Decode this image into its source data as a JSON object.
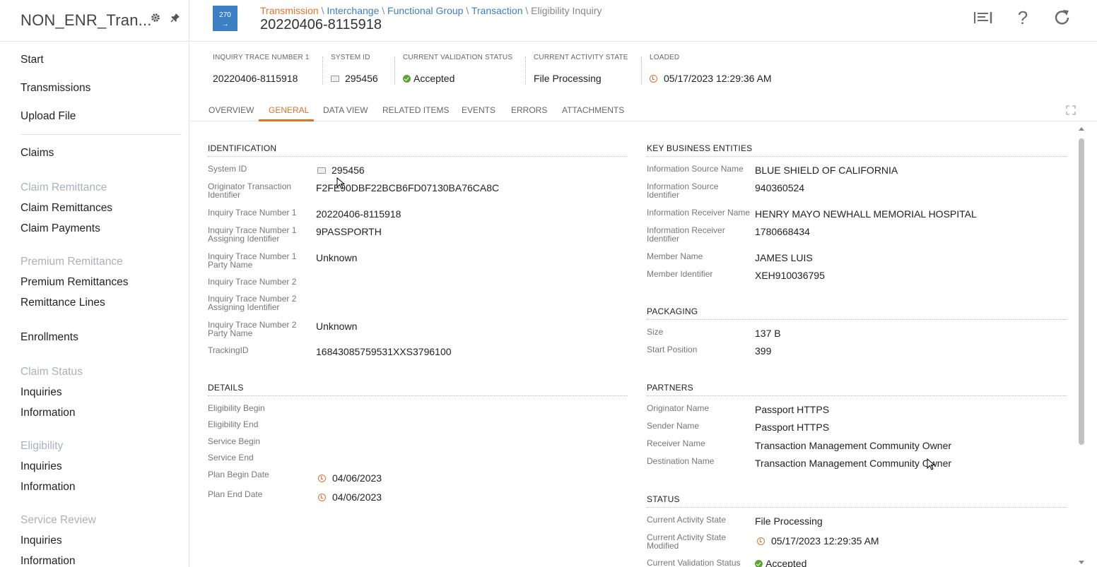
{
  "sidebar": {
    "title": "NON_ENR_Tran...",
    "items": {
      "start": "Start",
      "transmissions": "Transmissions",
      "upload_file": "Upload File",
      "claims": "Claims",
      "claim_remittance_section": "Claim Remittance",
      "claim_remittances": "Claim Remittances",
      "claim_payments": "Claim Payments",
      "premium_remittance_section": "Premium Remittance",
      "premium_remittances": "Premium Remittances",
      "remittance_lines": "Remittance Lines",
      "enrollments": "Enrollments",
      "claim_status_section": "Claim Status",
      "claim_status_inquiries": "Inquiries",
      "claim_status_information": "Information",
      "eligibility_section": "Eligibility",
      "eligibility_inquiries": "Inquiries",
      "eligibility_information": "Information",
      "service_review_section": "Service Review",
      "service_review_inquiries": "Inquiries",
      "service_review_information": "Information"
    }
  },
  "header": {
    "badge_number": "270",
    "badge_arrow": "→",
    "breadcrumb": {
      "transmission": "Transmission",
      "interchange": "Interchange",
      "functional_group": "Functional Group",
      "transaction": "Transaction",
      "current": "Eligibility Inquiry",
      "separator": " \\ "
    },
    "title": "20220406-8115918"
  },
  "summary": {
    "inquiry_trace_label": "INQUIRY TRACE NUMBER 1",
    "inquiry_trace_value": "20220406-8115918",
    "system_id_label": "SYSTEM ID",
    "system_id_value": "295456",
    "validation_label": "CURRENT VALIDATION STATUS",
    "validation_value": "Accepted",
    "activity_label": "CURRENT ACTIVITY STATE",
    "activity_value": "File Processing",
    "loaded_label": "LOADED",
    "loaded_value": "05/17/2023 12:29:36 AM"
  },
  "tabs": {
    "overview": "OVERVIEW",
    "general": "GENERAL",
    "data_view": "DATA VIEW",
    "related_items": "RELATED ITEMS",
    "events": "EVENTS",
    "errors": "ERRORS",
    "attachments": "ATTACHMENTS"
  },
  "identification": {
    "heading": "IDENTIFICATION",
    "system_id_label": "System ID",
    "system_id_value": "295456",
    "originator_label": "Originator Transaction Identifier",
    "originator_value": "F2FE90DBF22BCB6FD07130BA76CA8C",
    "trace1_label": "Inquiry Trace Number 1",
    "trace1_value": "20220406-8115918",
    "trace1_assign_label": "Inquiry Trace Number 1 Assigning Identifier",
    "trace1_assign_value": "9PASSPORTH",
    "trace1_party_label": "Inquiry Trace Number 1 Party Name",
    "trace1_party_value": "Unknown",
    "trace2_label": "Inquiry Trace Number 2",
    "trace2_assign_label": "Inquiry Trace Number 2 Assigning Identifier",
    "trace2_party_label": "Inquiry Trace Number 2 Party Name",
    "trace2_party_value": "Unknown",
    "tracking_label": "TrackingID",
    "tracking_value": "16843085759531XXS3796100"
  },
  "details": {
    "heading": "DETAILS",
    "eligibility_begin_label": "Eligibility Begin",
    "eligibility_end_label": "Eligibility End",
    "service_begin_label": "Service Begin",
    "service_end_label": "Service End",
    "plan_begin_label": "Plan Begin Date",
    "plan_begin_value": "04/06/2023",
    "plan_end_label": "Plan End Date",
    "plan_end_value": "04/06/2023"
  },
  "key_entities": {
    "heading": "KEY BUSINESS ENTITIES",
    "source_name_label": "Information Source Name",
    "source_name_value": "BLUE SHIELD OF CALIFORNIA",
    "source_id_label": "Information Source Identifier",
    "source_id_value": "940360524",
    "receiver_name_label": "Information Receiver Name",
    "receiver_name_value": "HENRY MAYO NEWHALL MEMORIAL HOSPITAL",
    "receiver_id_label": "Information Receiver Identifier",
    "receiver_id_value": "1780668434",
    "member_name_label": "Member Name",
    "member_name_value": "JAMES LUIS",
    "member_id_label": "Member Identifier",
    "member_id_value": "XEH910036795"
  },
  "packaging": {
    "heading": "PACKAGING",
    "size_label": "Size",
    "size_value": "137 B",
    "start_label": "Start Position",
    "start_value": "399"
  },
  "partners": {
    "heading": "PARTNERS",
    "originator_label": "Originator Name",
    "originator_value": "Passport HTTPS",
    "sender_label": "Sender Name",
    "sender_value": "Passport HTTPS",
    "receiver_label": "Receiver Name",
    "receiver_value": "Transaction Management Community Owner",
    "destination_label": "Destination Name",
    "destination_value": "Transaction Management Community Owner"
  },
  "status": {
    "heading": "STATUS",
    "activity_label": "Current Activity State",
    "activity_value": "File Processing",
    "activity_modified_label": "Current Activity State Modified",
    "activity_modified_value": "05/17/2023 12:29:35 AM",
    "validation_label": "Current Validation Status",
    "validation_value": "Accepted"
  },
  "colors": {
    "accent_orange": "#e0722f",
    "link_blue": "#3d7fc4",
    "success_green": "#5aa336",
    "section_gray": "#a9b2bc"
  }
}
